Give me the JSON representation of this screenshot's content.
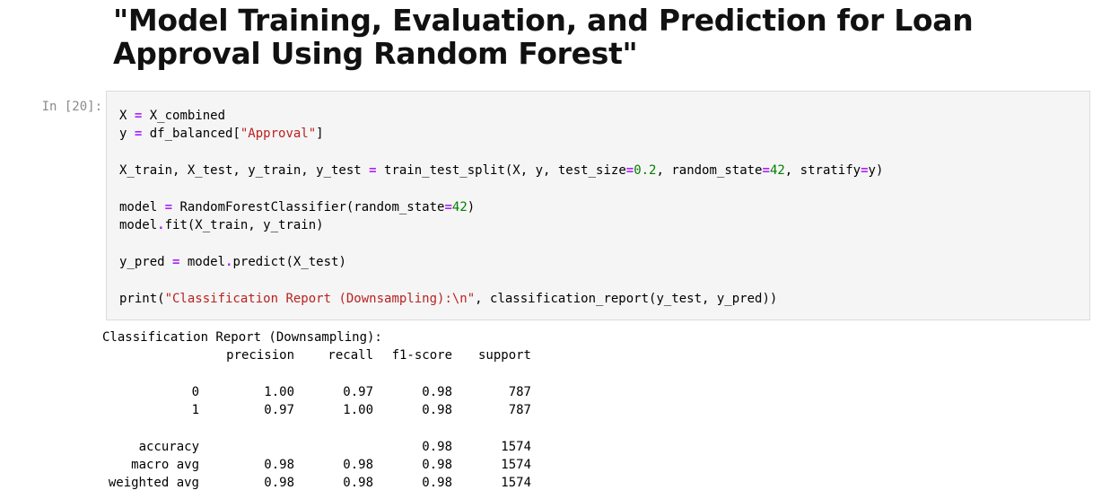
{
  "markdown_title": "\"Model Training, Evaluation, and Prediction for Loan Approval Using Random Forest\"",
  "cell": {
    "prompt": "In [20]:"
  },
  "code": {
    "l1": {
      "a": "X ",
      "op": "=",
      "b": " X_combined"
    },
    "l2": {
      "a": "y ",
      "op": "=",
      "b": " df_balanced[",
      "str": "\"Approval\"",
      "c": "]"
    },
    "l3": {
      "a": "X_train, X_test, y_train, y_test ",
      "op": "=",
      "b": " train_test_split(X, y, test_size",
      "op2": "=",
      "n1": "0.2",
      "c": ", random_state",
      "op3": "=",
      "n2": "42",
      "d": ", stratify",
      "op4": "=",
      "e": "y)"
    },
    "l4": {
      "a": "model ",
      "op": "=",
      "b": " RandomForestClassifier(random_state",
      "op2": "=",
      "n1": "42",
      "c": ")"
    },
    "l5": {
      "a": "model",
      "op": ".",
      "b": "fit(X_train, y_train)"
    },
    "l6": {
      "a": "y_pred ",
      "op": "=",
      "b": " model",
      "op2": ".",
      "c": "predict(X_test)"
    },
    "l7": {
      "a": "print(",
      "str": "\"Classification Report (Downsampling):\\n\"",
      "b": ", classification_report(y_test, y_pred))"
    }
  },
  "output": {
    "header": "Classification Report (Downsampling):",
    "columns": {
      "label": "",
      "precision": "precision",
      "recall": "recall",
      "f1": "f1-score",
      "support": "support"
    },
    "rows": [
      {
        "label": "0",
        "precision": "1.00",
        "recall": "0.97",
        "f1": "0.98",
        "support": "787"
      },
      {
        "label": "1",
        "precision": "0.97",
        "recall": "1.00",
        "f1": "0.98",
        "support": "787"
      }
    ],
    "summary": [
      {
        "label": "accuracy",
        "precision": "",
        "recall": "",
        "f1": "0.98",
        "support": "1574"
      },
      {
        "label": "macro avg",
        "precision": "0.98",
        "recall": "0.98",
        "f1": "0.98",
        "support": "1574"
      },
      {
        "label": "weighted avg",
        "precision": "0.98",
        "recall": "0.98",
        "f1": "0.98",
        "support": "1574"
      }
    ]
  }
}
